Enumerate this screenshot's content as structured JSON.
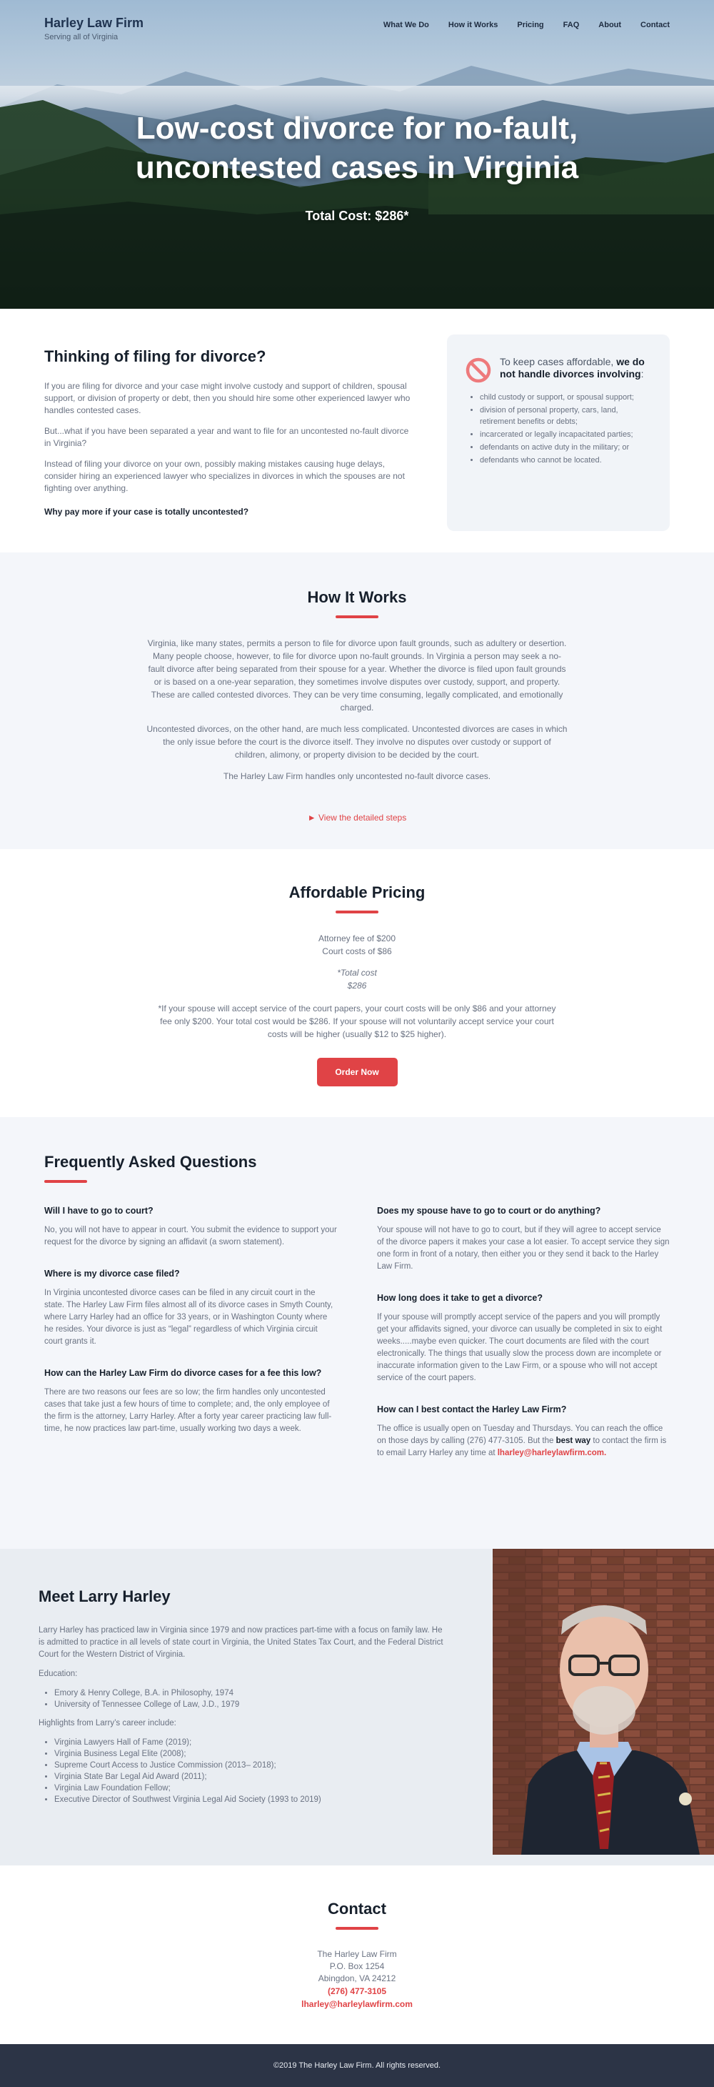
{
  "nav": {
    "brand_name": "Harley Law Firm",
    "brand_tagline": "Serving all of Virginia",
    "items": [
      "What We Do",
      "How it Works",
      "Pricing",
      "FAQ",
      "About",
      "Contact"
    ]
  },
  "hero": {
    "title_line1": "Low-cost divorce for no-fault,",
    "title_line2": "uncontested cases in Virginia",
    "total_cost": "Total Cost: $286*"
  },
  "intro": {
    "heading": "Thinking of filing for divorce?",
    "p1": "If you are filing for divorce and your case might involve custody and support of children, spousal support, or division of property or debt, then you should hire some other experienced lawyer who handles contested cases.",
    "p2": "But...what if you have been separated a year and want to file for an uncontested no-fault divorce in Virginia?",
    "p3": "Instead of filing your divorce on your own, possibly making mistakes causing huge delays, consider hiring an experienced lawyer who specializes in divorces in which the spouses are not fighting over anything.",
    "p4": "Why pay more if your case is totally uncontested?"
  },
  "notice": {
    "title_plain": "To keep cases affordable, ",
    "title_bold": "we do not handle divorces involving",
    "title_end": ":",
    "items": [
      "child custody or support, or spousal support;",
      "division of personal property, cars, land, retirement benefits or debts;",
      "incarcerated or legally incapacitated parties;",
      "defendants on active duty in the military; or",
      "defendants who cannot be located."
    ]
  },
  "how": {
    "heading": "How It Works",
    "p1": "Virginia, like many states, permits a person to file for divorce upon fault grounds, such as adultery or desertion. Many people choose, however, to file for divorce upon no-fault grounds. In Virginia a person may seek a no-fault divorce after being separated from their spouse for a year. Whether the divorce is filed upon fault grounds or is based on a one-year separation, they sometimes involve disputes over custody, support, and property. These are called contested divorces. They can be very time consuming, legally complicated, and emotionally charged.",
    "p2": "Uncontested divorces, on the other hand, are much less complicated. Uncontested divorces are cases in which the only issue before the court is the divorce itself. They involve no disputes over custody or support of children, alimony, or property division to be decided by the court.",
    "p3": "The Harley Law Firm handles only uncontested no-fault divorce cases.",
    "steps_link": "► View the detailed steps"
  },
  "pricing": {
    "heading": "Affordable Pricing",
    "attorney_fee": "Attorney fee of $200",
    "court_costs": "Court costs of $86",
    "total_label": "*Total cost",
    "total_value": "$286",
    "note": "*If your spouse will accept service of the court papers, your court costs will be only $86 and your attorney fee only $200. Your total cost would be $286. If your spouse will not voluntarily accept service your court costs will be higher (usually $12 to $25 higher).",
    "order_button": "Order Now"
  },
  "faq": {
    "heading": "Frequently Asked Questions",
    "left": [
      {
        "q": "Will I have to go to court?",
        "a": "No, you will not have to appear in court. You submit the evidence to support your request for the divorce by signing an affidavit (a sworn statement)."
      },
      {
        "q": "Where is my divorce case filed?",
        "a": "In Virginia uncontested divorce cases can be filed in any circuit court in the state. The Harley Law Firm files almost all of its divorce cases in Smyth County, where Larry Harley had an office for 33 years, or in Washington County where he resides. Your divorce is just as “legal” regardless of which Virginia circuit court grants it."
      },
      {
        "q": "How can the Harley Law Firm do divorce cases for a fee this low?",
        "a": "There are two reasons our fees are so low; the firm handles only uncontested cases that take just a few hours of time to complete; and, the only employee of the firm is the attorney, Larry Harley. After a forty year career practicing law full-time, he now practices law part-time, usually working two days a week."
      }
    ],
    "right": [
      {
        "q": "Does my spouse have to go to court or do anything?",
        "a": "Your spouse will not have to go to court, but if they will agree to accept service of the divorce papers it makes your case a lot easier. To accept service they sign one form in front of a notary, then either you or they send it back to the Harley Law Firm."
      },
      {
        "q": "How long does it take to get a divorce?",
        "a": "If your spouse will promptly accept service of the papers and you will promptly get your affidavits signed, your divorce can usually be completed in six to eight weeks.....maybe even quicker. The court documents are filed with the court electronically. The things that usually slow the process down are incomplete or inaccurate information given to the Law Firm, or a spouse who will not accept service of the court papers."
      },
      {
        "q": "How can I best contact the Harley Law Firm?",
        "a_start": "The office is usually open on Tuesday and Thursdays. You can reach the office on those days by calling (276) 477-3105. But the ",
        "a_bold": "best way",
        "a_mid": " to contact the firm is to email Larry Harley any time at ",
        "a_email": "lharley@harleylawfirm.com",
        "a_end": "."
      }
    ]
  },
  "about": {
    "heading": "Meet Larry Harley",
    "bio": "Larry Harley has practiced law in Virginia since 1979 and now practices part-time with a focus on family law. He is admitted to practice in all levels of state court in Virginia, the United States Tax Court, and the Federal District Court for the Western District of Virginia.",
    "education_label": "Education:",
    "education": [
      "Emory & Henry College, B.A. in Philosophy, 1974",
      "University of Tennessee College of Law, J.D., 1979"
    ],
    "highlights_label": "Highlights from Larry’s career include:",
    "highlights": [
      "Virginia Lawyers Hall of Fame (2019);",
      "Virginia Business Legal Elite (2008);",
      "Supreme Court Access to Justice Commission (2013– 2018);",
      "Virginia State Bar Legal Aid Award (2011);",
      "Virginia Law Foundation Fellow;",
      "Executive Director of Southwest Virginia Legal Aid Society (1993 to 2019)"
    ]
  },
  "contact": {
    "heading": "Contact",
    "firm": "The Harley Law Firm",
    "box": "P.O. Box 1254",
    "city": "Abingdon, VA 24212",
    "phone": "(276) 477-3105",
    "email": "lharley@harleylawfirm.com"
  },
  "footer": {
    "text": "©2019 The Harley Law Firm. All rights reserved."
  },
  "colors": {
    "accent": "#e04346",
    "navy": "#1f3350",
    "footer_bg": "#2c3446"
  },
  "icons": [
    "ban-icon",
    "triangle-right-icon"
  ]
}
